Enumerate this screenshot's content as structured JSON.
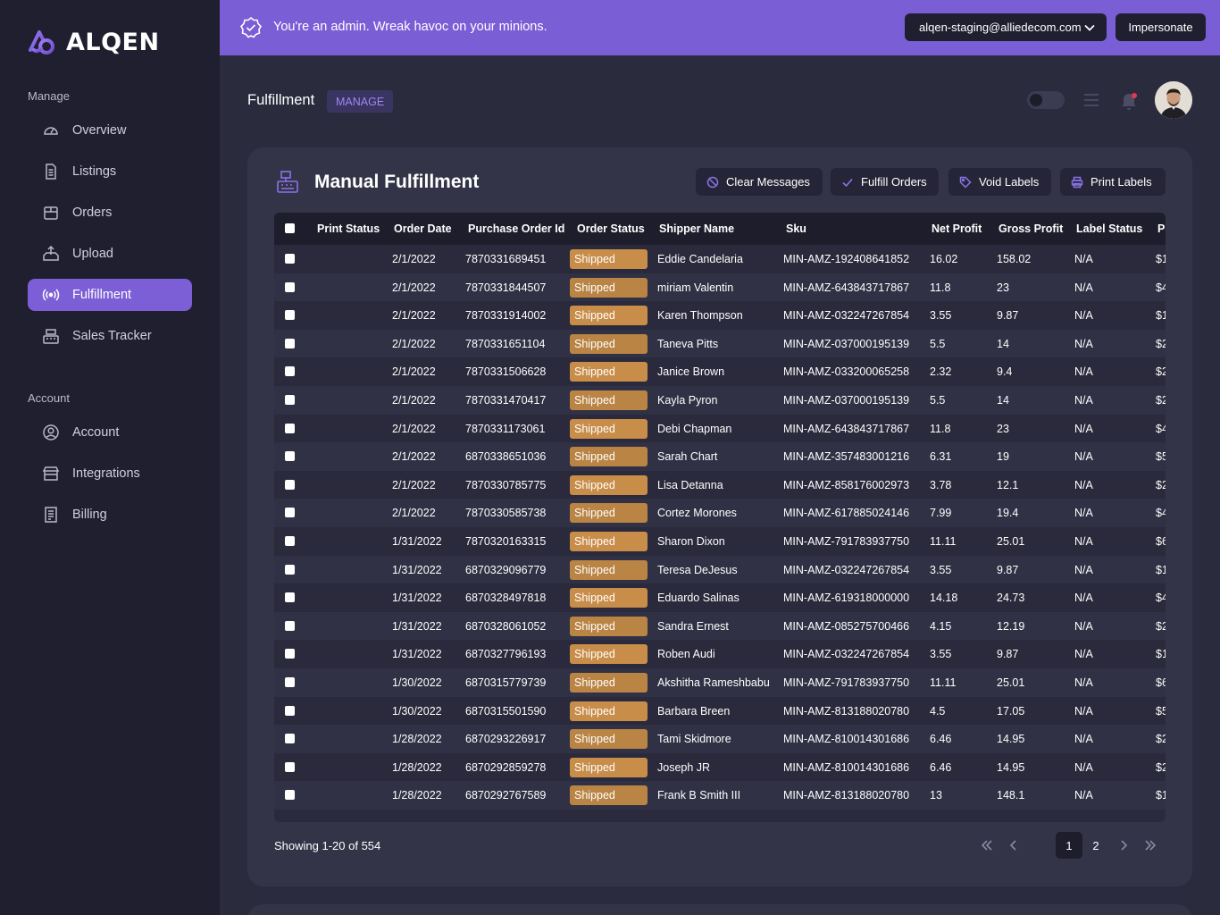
{
  "brand": {
    "name": "ALQEN"
  },
  "sidebar": {
    "manage_label": "Manage",
    "account_label": "Account",
    "manage_items": [
      {
        "label": "Overview",
        "icon": "gauge-icon"
      },
      {
        "label": "Listings",
        "icon": "document-icon"
      },
      {
        "label": "Orders",
        "icon": "box-icon"
      },
      {
        "label": "Upload",
        "icon": "upload-icon"
      },
      {
        "label": "Fulfillment",
        "icon": "broadcast-icon",
        "active": true
      },
      {
        "label": "Sales Tracker",
        "icon": "register-icon"
      }
    ],
    "account_items": [
      {
        "label": "Account",
        "icon": "user-circle-icon"
      },
      {
        "label": "Integrations",
        "icon": "store-icon"
      },
      {
        "label": "Billing",
        "icon": "receipt-icon"
      }
    ]
  },
  "banner": {
    "message": "You're an admin. Wreak havoc on your minions.",
    "env": "alqen-staging@alliedecom.com",
    "impersonate_label": "Impersonate"
  },
  "header": {
    "title": "Fulfillment",
    "badge": "MANAGE"
  },
  "card": {
    "title": "Manual Fulfillment",
    "buttons": {
      "clear": "Clear Messages",
      "fulfill": "Fulfill Orders",
      "void": "Void Labels",
      "print": "Print Labels"
    }
  },
  "table": {
    "columns": [
      "Print Status",
      "Order Date",
      "Purchase Order Id",
      "Order Status",
      "Shipper Name",
      "Sku",
      "Net Profit",
      "Gross Profit",
      "Label Status",
      "P"
    ],
    "rows": [
      {
        "date": "2/1/2022",
        "po": "7870331689451",
        "status": "Shipped",
        "shipper": "Eddie Candelaria",
        "sku": "MIN-AMZ-192408641852",
        "net": "16.02",
        "gross": "158.02",
        "label": "N/A",
        "p": "$1"
      },
      {
        "date": "2/1/2022",
        "po": "7870331844507",
        "status": "Shipped",
        "shipper": "miriam Valentin",
        "sku": "MIN-AMZ-643843717867",
        "net": "11.8",
        "gross": "23",
        "label": "N/A",
        "p": "$4"
      },
      {
        "date": "2/1/2022",
        "po": "7870331914002",
        "status": "Shipped",
        "shipper": "Karen Thompson",
        "sku": "MIN-AMZ-032247267854",
        "net": "3.55",
        "gross": "9.87",
        "label": "N/A",
        "p": "$1"
      },
      {
        "date": "2/1/2022",
        "po": "7870331651104",
        "status": "Shipped",
        "shipper": "Taneva Pitts",
        "sku": "MIN-AMZ-037000195139",
        "net": "5.5",
        "gross": "14",
        "label": "N/A",
        "p": "$2"
      },
      {
        "date": "2/1/2022",
        "po": "7870331506628",
        "status": "Shipped",
        "shipper": "Janice Brown",
        "sku": "MIN-AMZ-033200065258",
        "net": "2.32",
        "gross": "9.4",
        "label": "N/A",
        "p": "$2"
      },
      {
        "date": "2/1/2022",
        "po": "7870331470417",
        "status": "Shipped",
        "shipper": "Kayla Pyron",
        "sku": "MIN-AMZ-037000195139",
        "net": "5.5",
        "gross": "14",
        "label": "N/A",
        "p": "$2"
      },
      {
        "date": "2/1/2022",
        "po": "7870331173061",
        "status": "Shipped",
        "shipper": "Debi Chapman",
        "sku": "MIN-AMZ-643843717867",
        "net": "11.8",
        "gross": "23",
        "label": "N/A",
        "p": "$4"
      },
      {
        "date": "2/1/2022",
        "po": "6870338651036",
        "status": "Shipped",
        "shipper": "Sarah Chart",
        "sku": "MIN-AMZ-357483001216",
        "net": "6.31",
        "gross": "19",
        "label": "N/A",
        "p": "$5"
      },
      {
        "date": "2/1/2022",
        "po": "7870330785775",
        "status": "Shipped",
        "shipper": "Lisa Detanna",
        "sku": "MIN-AMZ-858176002973",
        "net": "3.78",
        "gross": "12.1",
        "label": "N/A",
        "p": "$2"
      },
      {
        "date": "2/1/2022",
        "po": "7870330585738",
        "status": "Shipped",
        "shipper": "Cortez Morones",
        "sku": "MIN-AMZ-617885024146",
        "net": "7.99",
        "gross": "19.4",
        "label": "N/A",
        "p": "$4"
      },
      {
        "date": "1/31/2022",
        "po": "7870320163315",
        "status": "Shipped",
        "shipper": "Sharon Dixon",
        "sku": "MIN-AMZ-791783937750",
        "net": "11.11",
        "gross": "25.01",
        "label": "N/A",
        "p": "$6"
      },
      {
        "date": "1/31/2022",
        "po": "6870329096779",
        "status": "Shipped",
        "shipper": "Teresa DeJesus",
        "sku": "MIN-AMZ-032247267854",
        "net": "3.55",
        "gross": "9.87",
        "label": "N/A",
        "p": "$1"
      },
      {
        "date": "1/31/2022",
        "po": "6870328497818",
        "status": "Shipped",
        "shipper": "Eduardo Salinas",
        "sku": "MIN-AMZ-619318000000",
        "net": "14.18",
        "gross": "24.73",
        "label": "N/A",
        "p": "$4"
      },
      {
        "date": "1/31/2022",
        "po": "6870328061052",
        "status": "Shipped",
        "shipper": "Sandra Ernest",
        "sku": "MIN-AMZ-085275700466",
        "net": "4.15",
        "gross": "12.19",
        "label": "N/A",
        "p": "$2"
      },
      {
        "date": "1/31/2022",
        "po": "6870327796193",
        "status": "Shipped",
        "shipper": "Roben Audi",
        "sku": "MIN-AMZ-032247267854",
        "net": "3.55",
        "gross": "9.87",
        "label": "N/A",
        "p": "$1"
      },
      {
        "date": "1/30/2022",
        "po": "6870315779739",
        "status": "Shipped",
        "shipper": "Akshitha Rameshbabu",
        "sku": "MIN-AMZ-791783937750",
        "net": "11.11",
        "gross": "25.01",
        "label": "N/A",
        "p": "$6"
      },
      {
        "date": "1/30/2022",
        "po": "6870315501590",
        "status": "Shipped",
        "shipper": "Barbara Breen",
        "sku": "MIN-AMZ-813188020780",
        "net": "4.5",
        "gross": "17.05",
        "label": "N/A",
        "p": "$5"
      },
      {
        "date": "1/28/2022",
        "po": "6870293226917",
        "status": "Shipped",
        "shipper": "Tami Skidmore",
        "sku": "MIN-AMZ-810014301686",
        "net": "6.46",
        "gross": "14.95",
        "label": "N/A",
        "p": "$2"
      },
      {
        "date": "1/28/2022",
        "po": "6870292859278",
        "status": "Shipped",
        "shipper": "Joseph JR",
        "sku": "MIN-AMZ-810014301686",
        "net": "6.46",
        "gross": "14.95",
        "label": "N/A",
        "p": "$2"
      },
      {
        "date": "1/28/2022",
        "po": "6870292767589",
        "status": "Shipped",
        "shipper": "Frank B Smith III",
        "sku": "MIN-AMZ-813188020780",
        "net": "13",
        "gross": "148.1",
        "label": "N/A",
        "p": "$1"
      }
    ]
  },
  "pagination": {
    "showing": "Showing 1-20 of 554",
    "pages": [
      "1",
      "2"
    ],
    "current": "1"
  },
  "colors": {
    "accent": "#7c5fd6",
    "banner": "#7a5ed6",
    "sidebar": "#1f1f30",
    "status_shipped": "#c98d4a"
  }
}
